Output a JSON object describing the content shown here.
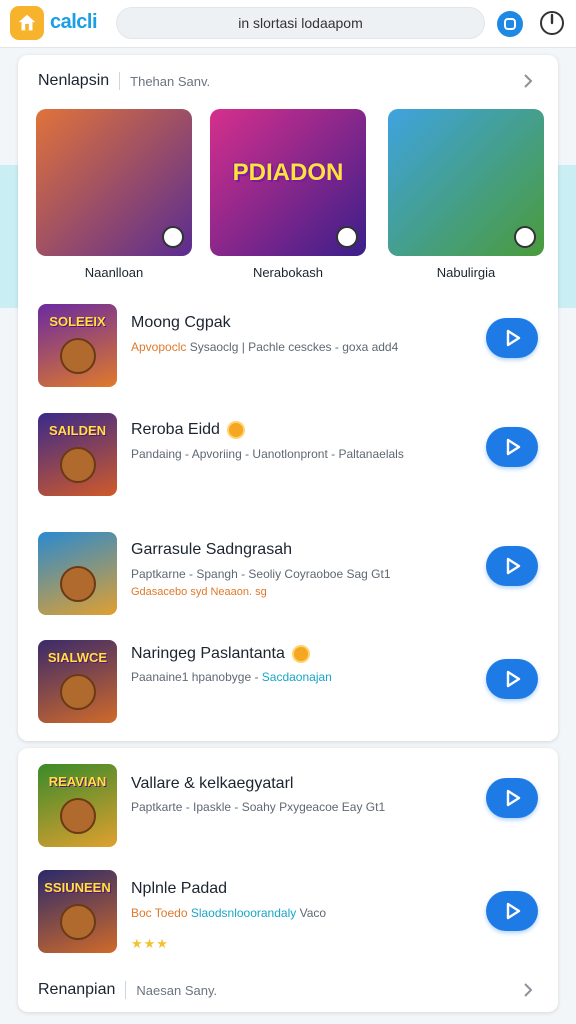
{
  "header": {
    "brand": "calcli",
    "search_text": "in slortasi lodaapom"
  },
  "section1": {
    "title": "Nenlapsin",
    "subtitle": "Thehan Sanv.",
    "featured": [
      {
        "name": "Naanlloan",
        "art_text": "",
        "colors": [
          "#e0733a",
          "#5a2c91"
        ]
      },
      {
        "name": "Nerabokash",
        "art_text": "PDIADON",
        "colors": [
          "#d62f8c",
          "#3a1f8a"
        ]
      },
      {
        "name": "Nabulirgia",
        "art_text": "",
        "colors": [
          "#3fa3e0",
          "#4a9b3a"
        ]
      }
    ],
    "games": [
      {
        "title": "Moong Cgpak",
        "coin": false,
        "subtitle_parts": [
          "Apvopoclc",
          " Sysaoclg | Pachle cesckes - goxa add4"
        ],
        "subtitle_accents": [
          "orange",
          "none"
        ],
        "subtitle2": "",
        "thumb_text": "SOLEEIX",
        "colors": [
          "#6a2aa0",
          "#e07a2a"
        ]
      },
      {
        "title": "Reroba Eidd",
        "coin": true,
        "subtitle_parts": [
          "Pandaing - Apvoriing - Uanotlonpront - Paltanaelals"
        ],
        "subtitle_accents": [
          "none"
        ],
        "subtitle2": "",
        "thumb_text": "SAILDEN",
        "colors": [
          "#3a2a8a",
          "#d05a2a"
        ]
      },
      {
        "title": "Garrasule Sadngrasah",
        "coin": false,
        "subtitle_parts": [
          "Paptkarne - Spangh - Seoliy Coyraoboe Sag Gt1"
        ],
        "subtitle_accents": [
          "none"
        ],
        "subtitle2": "Gdasacebo syd Neaaon. sg",
        "thumb_text": "",
        "colors": [
          "#2a8ad0",
          "#e0a030"
        ]
      },
      {
        "title": "Naringeg Paslantanta",
        "coin": true,
        "subtitle_parts": [
          "Paanaine1 hpanobyge - ",
          "Sacdaonajan"
        ],
        "subtitle_accents": [
          "none",
          "teal"
        ],
        "subtitle2": "",
        "thumb_text": "SIALWCE",
        "colors": [
          "#3a2a6a",
          "#d06a2a"
        ]
      }
    ]
  },
  "section2": {
    "title": "Renanpian",
    "subtitle": "Naesan Sany.",
    "games": [
      {
        "title": "Vallare & kelkaegyatarl",
        "coin": false,
        "subtitle_parts": [
          "Paptkarte - Ipaskle - Soahy Pxygeacoe Eay Gt1"
        ],
        "subtitle_accents": [
          "none"
        ],
        "thumb_text": "REAVIAN",
        "colors": [
          "#3a8a2a",
          "#e0a030"
        ]
      },
      {
        "title": "Nplnle Padad",
        "coin": false,
        "subtitle_parts": [
          "Boc Toedo ",
          "Slaodsnlooorandaly",
          " Vaco"
        ],
        "subtitle_accents": [
          "orange",
          "teal",
          "none"
        ],
        "stars": "★★★",
        "thumb_text": "SSIUNEEN",
        "colors": [
          "#2a2a6a",
          "#d06a2a"
        ]
      }
    ]
  },
  "colors": {
    "accent_blue": "#1e7be6",
    "brand_blue": "#1a9ee6",
    "logo_yellow": "#f7b32b",
    "band_teal": "#c9eef4"
  },
  "icons": [
    "home-logo-icon",
    "profile-icon",
    "power-icon",
    "chevron-right-icon",
    "play-icon",
    "coin-icon",
    "star-icon"
  ]
}
